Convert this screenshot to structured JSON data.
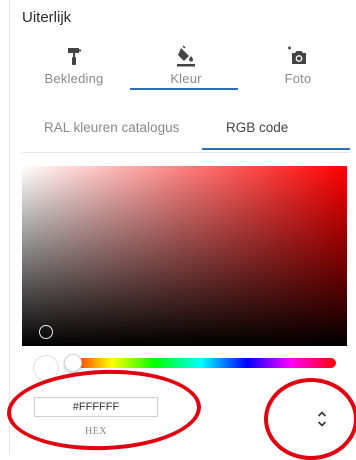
{
  "panel": {
    "title": "Uiterlijk"
  },
  "main_tabs": [
    {
      "label": "Bekleding",
      "icon": "paint-roller-icon",
      "active": false
    },
    {
      "label": "Kleur",
      "icon": "paint-bucket-icon",
      "active": true
    },
    {
      "label": "Foto",
      "icon": "add-photo-icon",
      "active": false
    }
  ],
  "sub_tabs": [
    {
      "label": "RAL kleuren catalogus",
      "active": false
    },
    {
      "label": "RGB code",
      "active": true
    }
  ],
  "color_picker": {
    "hue_color": "#ff0000",
    "hex_value": "#FFFFFF",
    "hex_label": "HEX",
    "toggle_icon": "chevron-up-down-icon"
  },
  "colors": {
    "accent": "#2f6fb0",
    "annotation": "#e0000f"
  }
}
